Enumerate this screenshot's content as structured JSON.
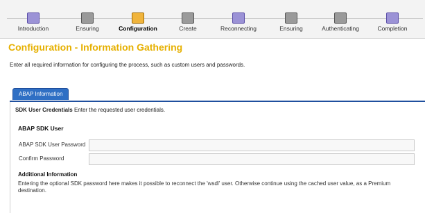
{
  "steps": [
    {
      "label": "Introduction",
      "icon": "info-icon"
    },
    {
      "label": "Ensuring",
      "icon": "check-icon"
    },
    {
      "label": "Configuration",
      "icon": "gear-icon"
    },
    {
      "label": "Create",
      "icon": "plus-icon"
    },
    {
      "label": "Reconnecting",
      "icon": "plug-icon"
    },
    {
      "label": "Ensuring",
      "icon": "check-icon"
    },
    {
      "label": "Authenticating",
      "icon": "key-icon"
    },
    {
      "label": "Completion",
      "icon": "flag-icon"
    }
  ],
  "active_step": "Configuration",
  "page": {
    "title": "Configuration - Information Gathering",
    "description": "Enter all required information for configuring the process, such as custom users and passwords."
  },
  "tabs": [
    "ABAP Information"
  ],
  "form": {
    "hint_label": "SDK User Credentials",
    "hint_text": "Enter the requested user credentials.",
    "section_title": "ABAP SDK User",
    "user_label": "ABAP SDK User Password",
    "confirm_label": "Confirm Password",
    "user_value": "",
    "confirm_value": ""
  },
  "additional": {
    "title": "Additional Information",
    "text": "Entering the optional SDK password here makes it possible to reconnect the 'wsdl' user. Otherwise continue using the cached user value, as a Premium destination."
  },
  "colors": {
    "title": "#e6b000",
    "tab": "#2f6fc4",
    "step_active": "#f0b43c",
    "step_done": "#9b92d6"
  }
}
